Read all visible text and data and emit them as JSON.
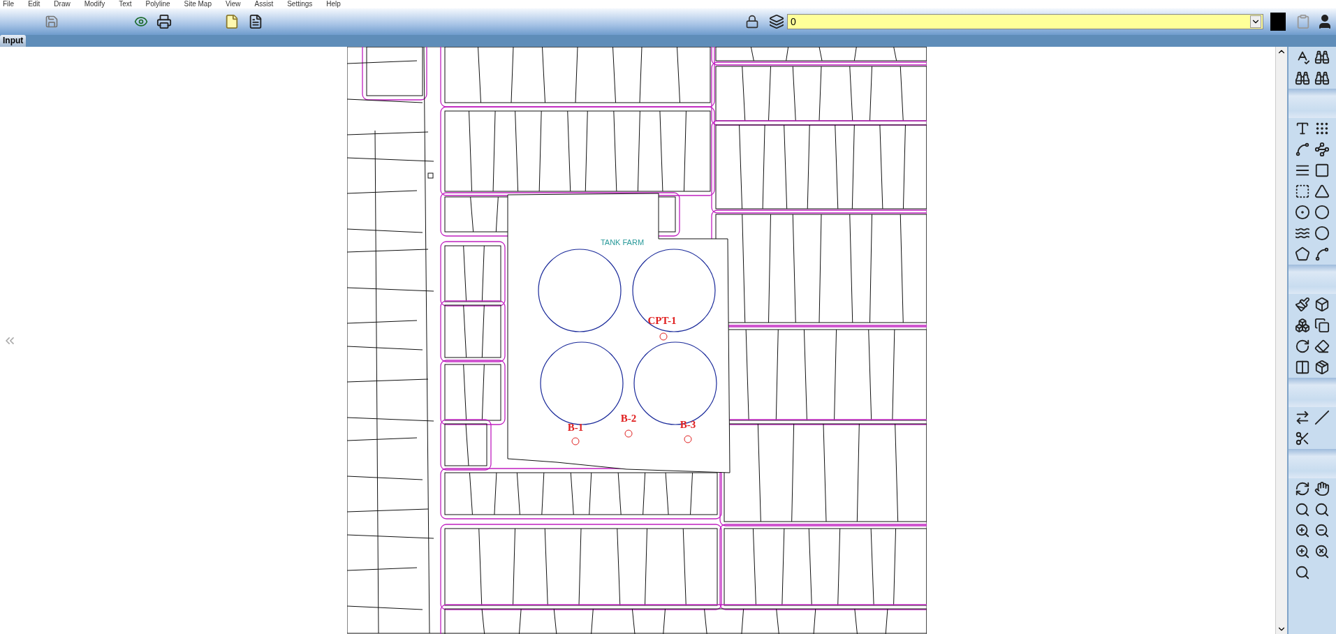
{
  "menu": [
    "File",
    "Edit",
    "Draw",
    "Modify",
    "Text",
    "Polyline",
    "Site Map",
    "View",
    "Assist",
    "Settings",
    "Help"
  ],
  "toolbar": {
    "layer_field": {
      "value": "0"
    }
  },
  "tabs": [
    {
      "label": "Input",
      "selected": true
    }
  ],
  "map": {
    "labels": [
      {
        "kind": "area",
        "text": "TANK FARM"
      },
      {
        "kind": "boring",
        "text": "CPT-1"
      },
      {
        "kind": "boring",
        "text": "B-1"
      },
      {
        "kind": "boring",
        "text": "B-2"
      },
      {
        "kind": "boring",
        "text": "B-3"
      }
    ]
  }
}
